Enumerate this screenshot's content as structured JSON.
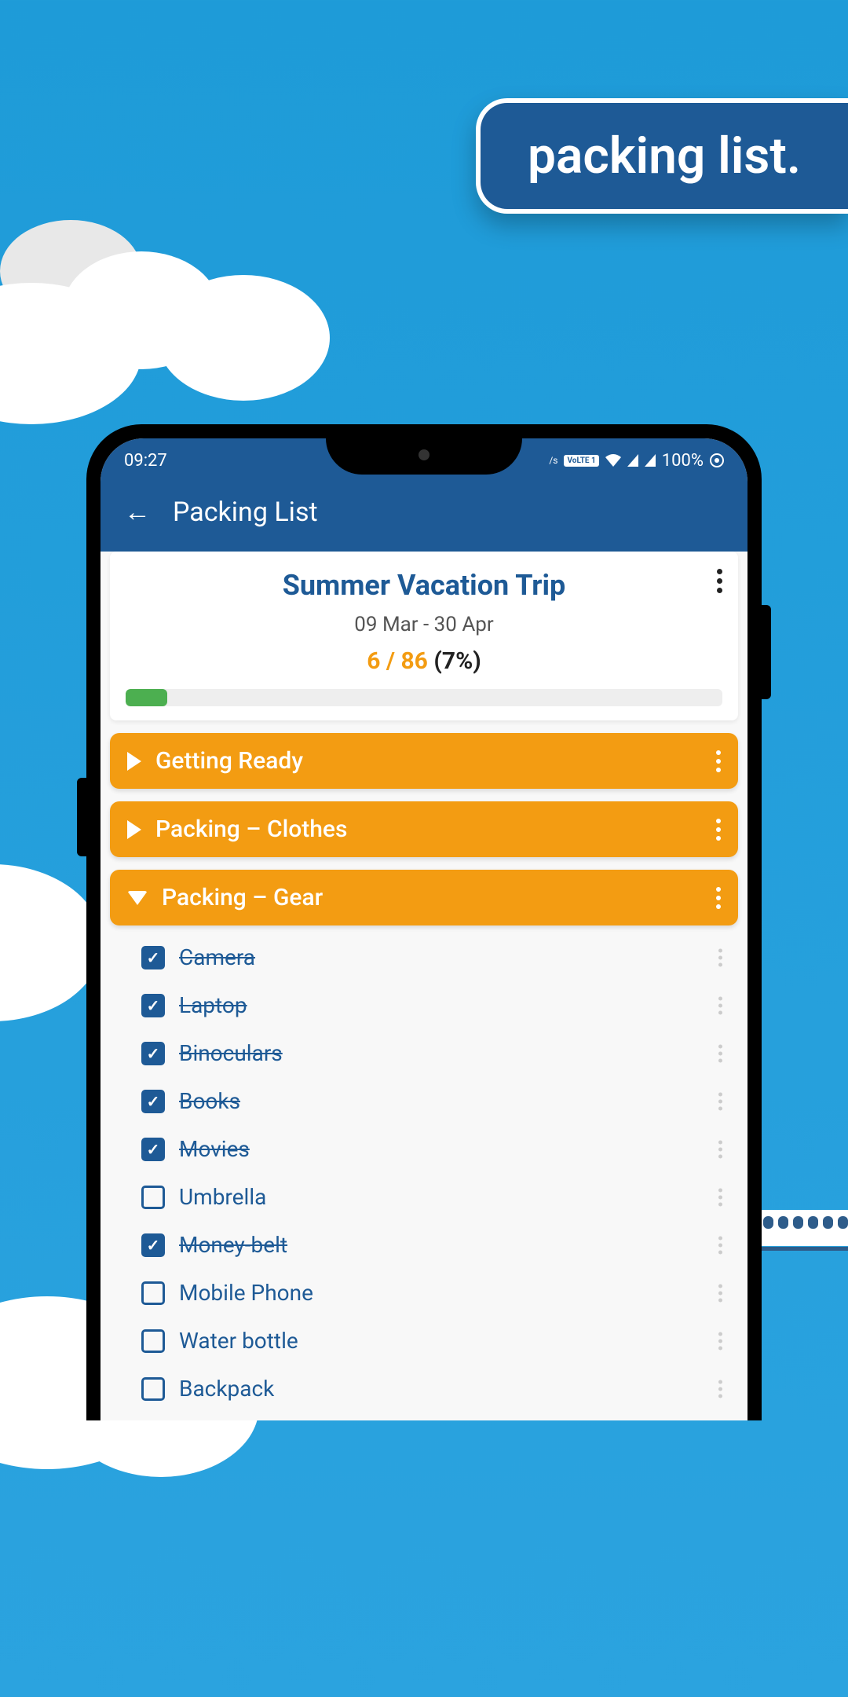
{
  "banner": {
    "text": "packing list."
  },
  "status_bar": {
    "time": "09:27",
    "volte": "VoLTE 1",
    "battery": "100%"
  },
  "app_header": {
    "title": "Packing List"
  },
  "trip": {
    "title": "Summer Vacation Trip",
    "dates": "09 Mar - 30 Apr",
    "progress": {
      "done": "6",
      "total": "86",
      "pct": "(7%)",
      "bar_width": "7%"
    }
  },
  "sections": [
    {
      "title": "Getting Ready",
      "expanded": false
    },
    {
      "title": "Packing – Clothes",
      "expanded": false
    },
    {
      "title": "Packing – Gear",
      "expanded": true
    }
  ],
  "items": [
    {
      "label": "Camera",
      "checked": true
    },
    {
      "label": "Laptop",
      "checked": true
    },
    {
      "label": "Binoculars",
      "checked": true
    },
    {
      "label": "Books",
      "checked": true
    },
    {
      "label": "Movies",
      "checked": true
    },
    {
      "label": "Umbrella",
      "checked": false
    },
    {
      "label": "Money-belt",
      "checked": true
    },
    {
      "label": "Mobile Phone",
      "checked": false
    },
    {
      "label": "Water bottle",
      "checked": false
    },
    {
      "label": "Backpack",
      "checked": false
    }
  ]
}
